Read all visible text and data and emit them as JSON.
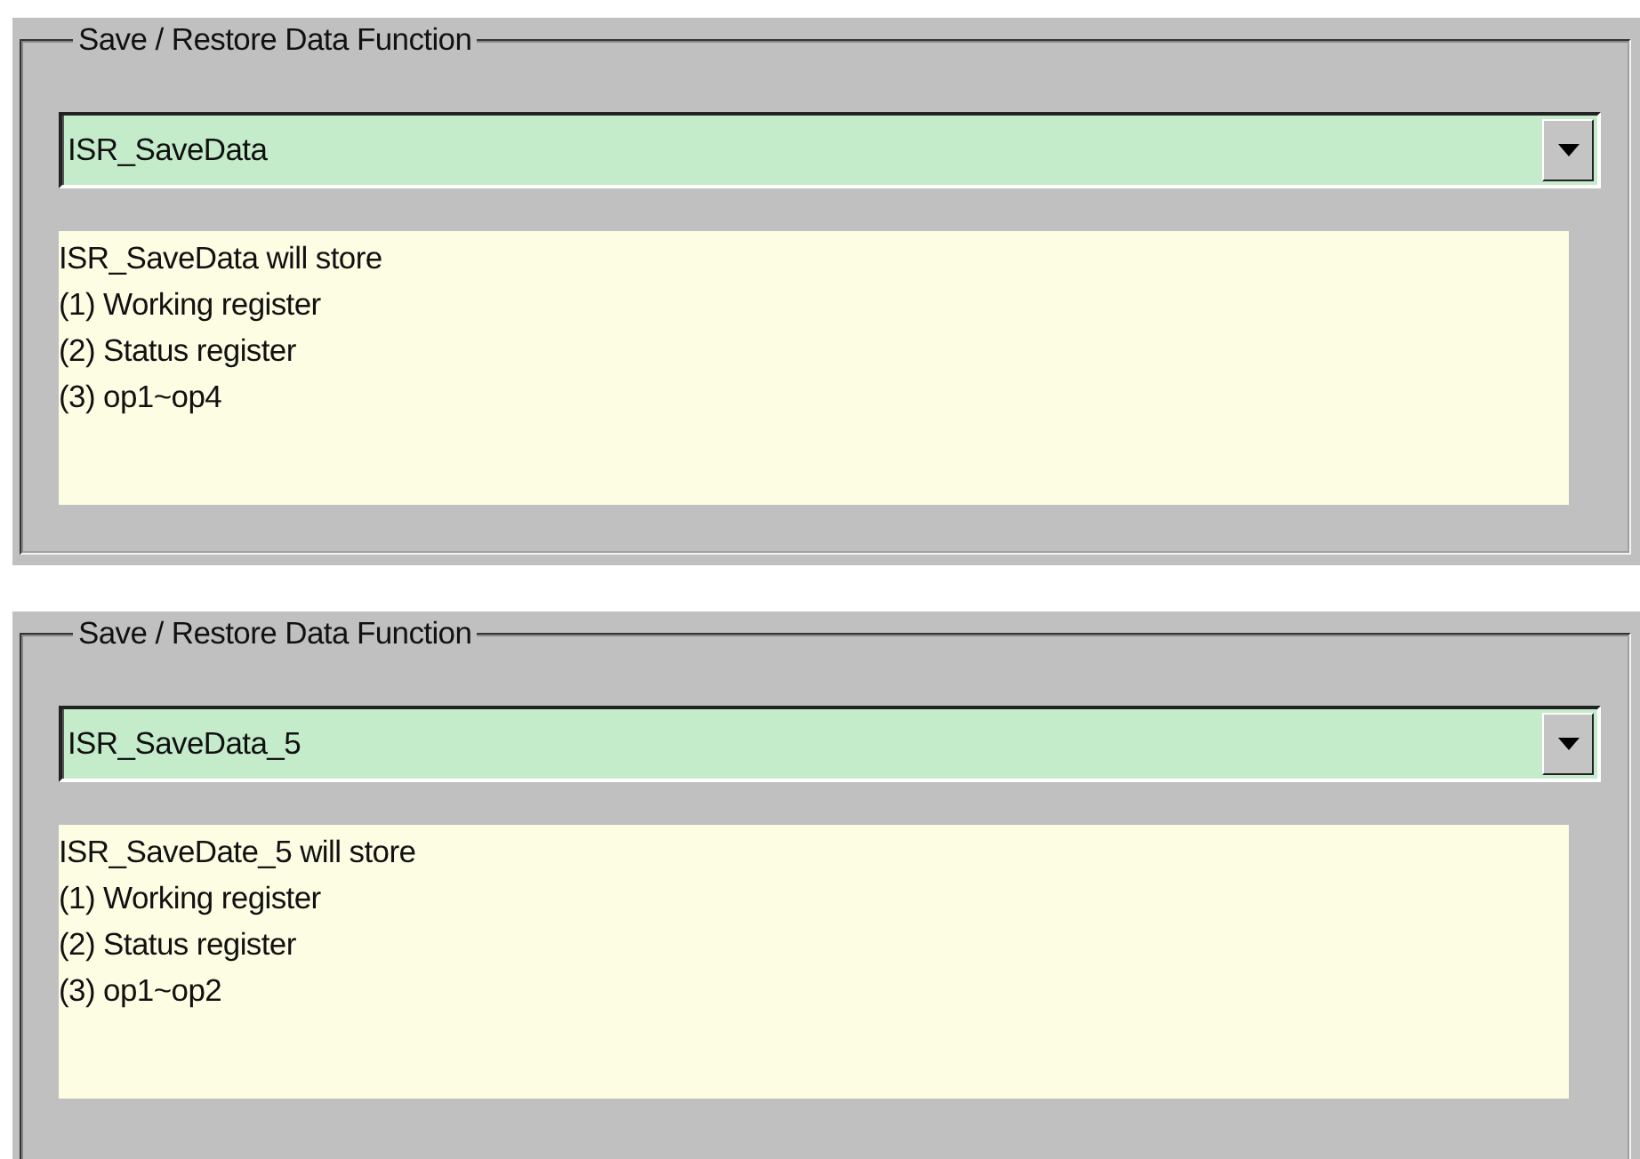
{
  "panels": [
    {
      "title": "Save / Restore Data Function",
      "combo": {
        "value": "ISR_SaveData"
      },
      "description": [
        "ISR_SaveData will store",
        "(1) Working register",
        "(2) Status register",
        "(3) op1~op4"
      ]
    },
    {
      "title": "Save / Restore Data Function",
      "combo": {
        "value": "ISR_SaveData_5"
      },
      "description": [
        "ISR_SaveDate_5 will store",
        "(1) Working register",
        "(2) Status register",
        "(3) op1~op2"
      ]
    }
  ]
}
